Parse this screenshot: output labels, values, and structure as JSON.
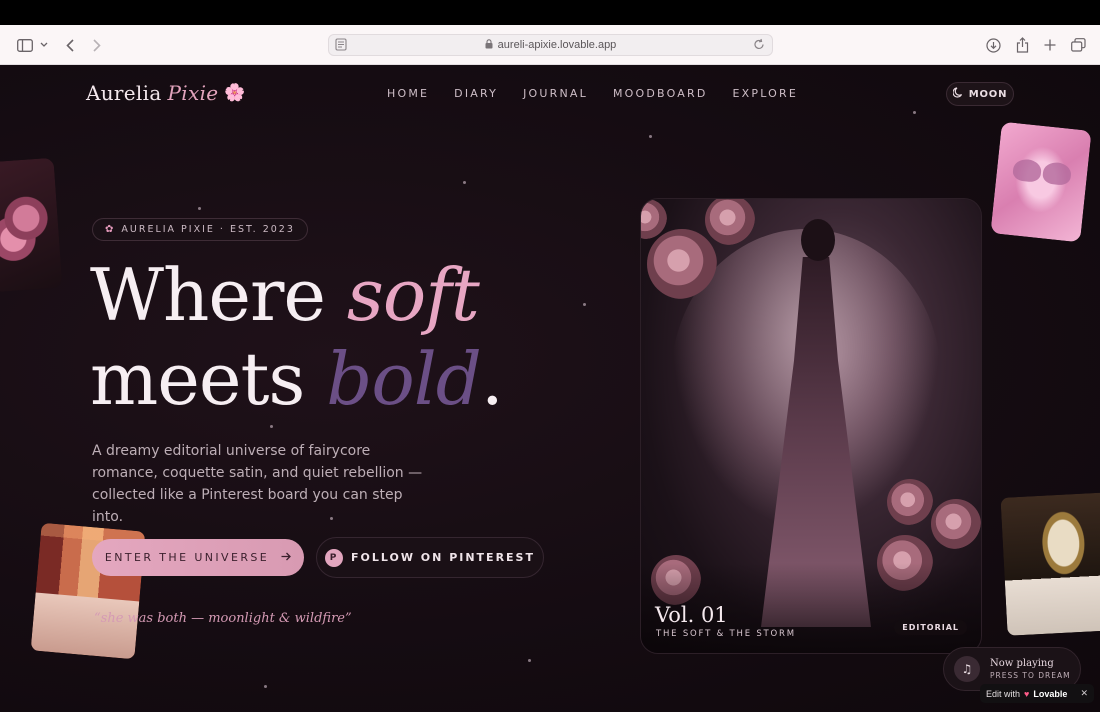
{
  "browser": {
    "url": "aureli-apixie.lovable.app"
  },
  "brand": {
    "name": "Aurelia",
    "accent": "Pixie",
    "flower": "🌸"
  },
  "nav": {
    "items": [
      "HOME",
      "DIARY",
      "JOURNAL",
      "MOODBOARD",
      "EXPLORE"
    ],
    "theme_label": "MOON"
  },
  "hero": {
    "badge": "AURELIA PIXIE · EST. 2023",
    "headline_1": "Where ",
    "headline_1_accent": "soft",
    "headline_2": "meets ",
    "headline_2_accent": "bold",
    "headline_2_end": ".",
    "subtitle": "A dreamy editorial universe of fairycore romance, coquette satin, and quiet rebellion — collected like a Pinterest board you can step into.",
    "cta_primary": "ENTER THE UNIVERSE",
    "cta_secondary": "FOLLOW ON PINTEREST",
    "cta_secondary_icon_letter": "P",
    "quote": "“she was both — moonlight & wildfire”"
  },
  "feature_card": {
    "title": "Vol. 01",
    "subtitle": "THE SOFT & THE STORM",
    "tag": "EDITORIAL"
  },
  "now_playing": {
    "title": "Now playing",
    "subtitle": "PRESS TO DREAM"
  },
  "lovable": {
    "prefix": "Edit with",
    "brand": "Lovable"
  },
  "colors": {
    "accent_pink": "#e7a6c3",
    "accent_purple": "#6b4f86",
    "background": "#150c12"
  }
}
